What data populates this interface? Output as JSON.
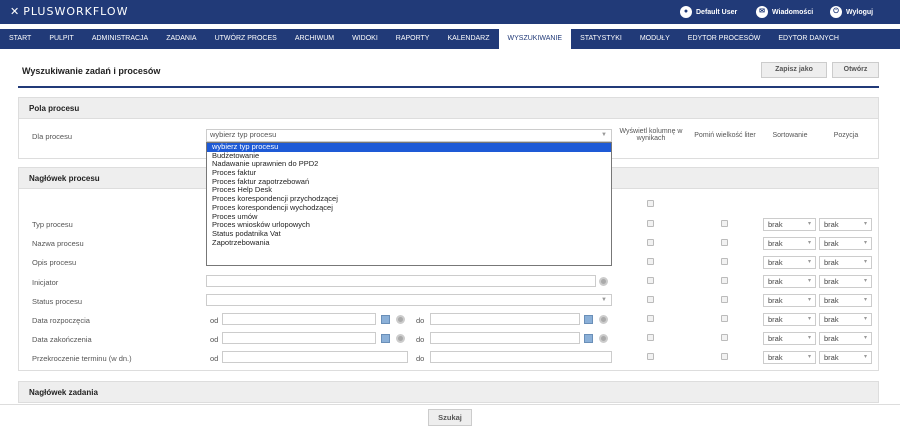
{
  "header": {
    "logo": "PLUSWORKFLOW",
    "user": "Default User",
    "messages": "Wiadomości",
    "logout": "Wyloguj"
  },
  "nav": [
    "START",
    "PULPIT",
    "ADMINISTRACJA",
    "ZADANIA",
    "UTWÓRZ PROCES",
    "ARCHIWUM",
    "WIDOKI",
    "RAPORTY",
    "KALENDARZ",
    "WYSZUKIWANIE",
    "STATYSTYKI",
    "MODUŁY",
    "EDYTOR PROCESÓW",
    "EDYTOR DANYCH"
  ],
  "nav_active": "WYSZUKIWANIE",
  "page": {
    "title": "Wyszukiwanie zadań i procesów",
    "save_as": "Zapisz jako",
    "open": "Otwórz"
  },
  "section_process": {
    "title": "Pola procesu",
    "label": "Dla procesu",
    "select_value": "wybierz typ procesu",
    "col_show": "Wyświetl kolumnę w wynikach",
    "col_case": "Pomiń wielkość liter",
    "col_sort": "Sortowanie",
    "col_pos": "Pozycja"
  },
  "dropdown_options": [
    "wybierz typ procesu",
    "Budżetowanie",
    "Nadawanie uprawnien do PPD2",
    "Proces faktur",
    "Proces faktur zapotrzebowań",
    "Proces Help Desk",
    "Proces korespondencji przychodzącej",
    "Proces korespondencji wychodzącej",
    "Proces umów",
    "Proces wniosków urlopowych",
    "Status podatnika Vat",
    "Zapotrzebowania"
  ],
  "section_header": {
    "title": "Nagłówek procesu",
    "rows": [
      "Typ procesu",
      "Nazwa procesu",
      "Opis procesu",
      "Inicjator",
      "Status procesu",
      "Data rozpoczęcia",
      "Data zakończenia",
      "Przekroczenie terminu (w dn.)"
    ],
    "od": "od",
    "do": "do",
    "sort_value": "brak",
    "pos_value": "brak"
  },
  "section_task": {
    "title": "Nagłówek zadania"
  },
  "footer": {
    "search": "Szukaj"
  }
}
